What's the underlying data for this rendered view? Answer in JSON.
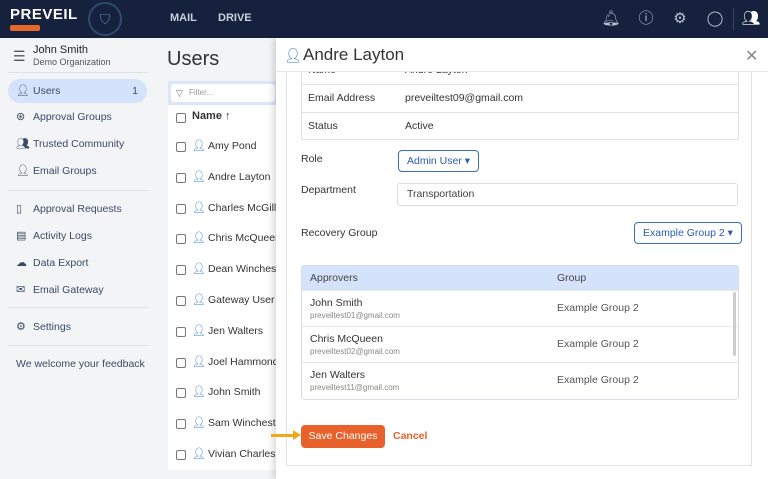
{
  "topbar": {
    "brand": "PREVEIL",
    "nav": [
      "MAIL",
      "DRIVE"
    ],
    "icons": [
      "bell-icon",
      "help-icon",
      "gear-icon",
      "profile-icon",
      "users-icon"
    ]
  },
  "sidebar": {
    "user_name": "John Smith",
    "org": "Demo Organization",
    "items": [
      {
        "label": "Users",
        "count": "1",
        "icon": "user-icon"
      },
      {
        "label": "Approval Groups",
        "icon": "group-icon"
      },
      {
        "label": "Trusted Community",
        "icon": "community-icon"
      },
      {
        "label": "Email Groups",
        "icon": "user-plus-icon"
      },
      {
        "label": "Approval Requests",
        "icon": "clipboard-icon"
      },
      {
        "label": "Activity Logs",
        "icon": "log-icon"
      },
      {
        "label": "Data Export",
        "icon": "cloud-icon"
      },
      {
        "label": "Email Gateway",
        "icon": "mail-icon"
      },
      {
        "label": "Settings",
        "icon": "gear-icon"
      }
    ],
    "feedback": "We welcome your feedback"
  },
  "users": {
    "title": "Users",
    "filter_placeholder": "Filter...",
    "column": "Name ↑",
    "rows": [
      "Amy Pond",
      "Andre Layton",
      "Charles McGill",
      "Chris McQueen",
      "Dean Winchester",
      "Gateway User",
      "Jen Walters",
      "Joel Hammond",
      "John Smith",
      "Sam Winchester",
      "Vivian Charles"
    ]
  },
  "modal": {
    "title": "Andre Layton",
    "info": [
      {
        "k": "Name",
        "v": "Andre Layton"
      },
      {
        "k": "Email Address",
        "v": "preveiltest09@gmail.com"
      },
      {
        "k": "Status",
        "v": "Active"
      }
    ],
    "role_label": "Role",
    "role": "Admin User ▾",
    "dept_label": "Department",
    "dept": "Transportation",
    "recovery_label": "Recovery Group",
    "recovery": "Example Group 2 ▾",
    "table": {
      "headers": [
        "Approvers",
        "Group"
      ],
      "rows": [
        {
          "name": "John Smith",
          "email": "preveiltest01@gmail.com",
          "group": "Example Group 2"
        },
        {
          "name": "Chris McQueen",
          "email": "preveiltest02@gmail.com",
          "group": "Example Group 2"
        },
        {
          "name": "Jen Walters",
          "email": "preveiltest11@gmail.com",
          "group": "Example Group 2"
        }
      ]
    },
    "save": "Save Changes",
    "cancel": "Cancel"
  },
  "colors": {
    "accent": "#e8612b",
    "topbar": "#15213d",
    "highlight": "#d4e2fb"
  }
}
